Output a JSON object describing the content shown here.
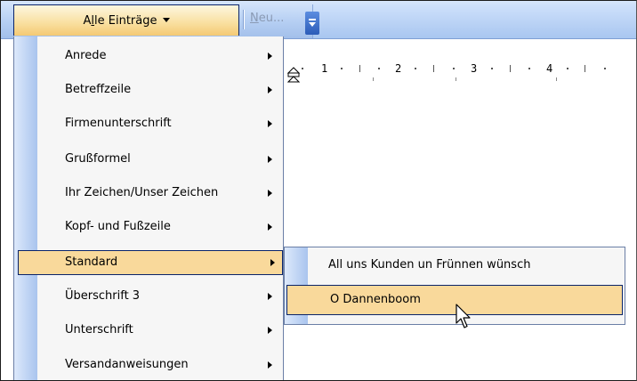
{
  "toolbar": {
    "all_entries_label_pre": "A",
    "all_entries_label_accel": "l",
    "all_entries_label_post": "le Einträge",
    "new_label_accel": "N",
    "new_label_post": "eu..."
  },
  "ruler": {
    "numbers": [
      "1",
      "2",
      "3",
      "4"
    ]
  },
  "menu": {
    "items": [
      {
        "label": "Anrede",
        "has_submenu": true
      },
      {
        "label": "Betreffzeile",
        "has_submenu": true
      },
      {
        "label": "Firmenunterschrift",
        "has_submenu": true
      },
      {
        "label": "Grußformel",
        "has_submenu": true
      },
      {
        "label": "Ihr Zeichen/Unser Zeichen",
        "has_submenu": true
      },
      {
        "label": "Kopf- und Fußzeile",
        "has_submenu": true
      },
      {
        "label": "Standard",
        "has_submenu": true,
        "highlighted": true
      },
      {
        "label": "Überschrift 3",
        "has_submenu": true
      },
      {
        "label": "Unterschrift",
        "has_submenu": true
      },
      {
        "label": "Versandanweisungen",
        "has_submenu": true
      }
    ]
  },
  "submenu": {
    "items": [
      {
        "label": "All uns Kunden un Frünnen wünsch"
      },
      {
        "label": "O Dannenboom",
        "highlighted": true
      }
    ]
  },
  "colors": {
    "highlight": "#f9d99b",
    "highlight_border": "#0a246a",
    "toolbar_blue": "#b6cff3"
  }
}
